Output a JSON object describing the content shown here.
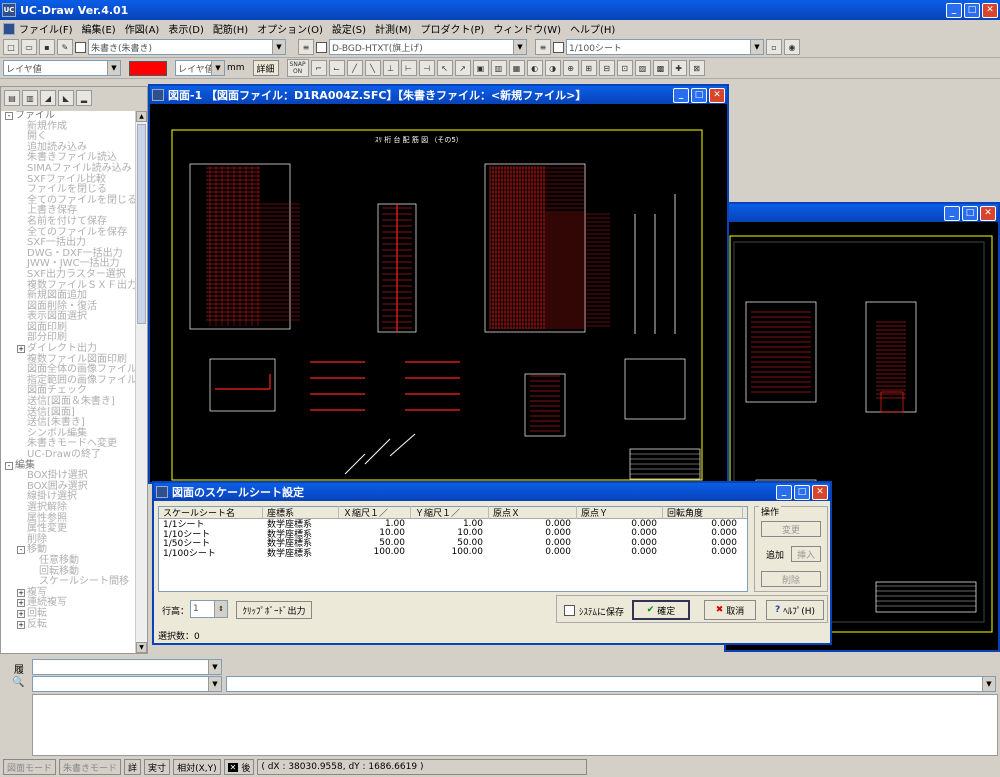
{
  "app": {
    "title": "UC-Draw Ver.4.01"
  },
  "menu": [
    "ファイル(F)",
    "編集(E)",
    "作図(A)",
    "表示(D)",
    "配筋(H)",
    "オプション(O)",
    "設定(S)",
    "計測(M)",
    "プロダクト(P)",
    "ウィンドウ(W)",
    "ヘルプ(H)"
  ],
  "toolbar1": {
    "layer_combo": "朱書き(朱書き)",
    "bgd_combo": "D-BGD-HTXT(旗上げ)",
    "sheet_combo": "1/100シート"
  },
  "toolbar2": {
    "color_combo": "レイヤ値",
    "linetype_combo": "レイヤ値",
    "unit": "mm",
    "detail_button": "詳細",
    "snap_label": "SNAP ON"
  },
  "tree": {
    "items": [
      {
        "t": "ファイル",
        "lv": 0,
        "g": "-"
      },
      {
        "t": "新規作成",
        "lv": 1
      },
      {
        "t": "開く",
        "lv": 1
      },
      {
        "t": "追加読み込み",
        "lv": 1
      },
      {
        "t": "朱書きファイル読込",
        "lv": 1
      },
      {
        "t": "SIMAファイル読み込み",
        "lv": 1
      },
      {
        "t": "SXFファイル比較",
        "lv": 1
      },
      {
        "t": "ファイルを閉じる",
        "lv": 1
      },
      {
        "t": "全てのファイルを閉じる",
        "lv": 1
      },
      {
        "t": "上書き保存",
        "lv": 1
      },
      {
        "t": "名前を付けて保存",
        "lv": 1
      },
      {
        "t": "全てのファイルを保存",
        "lv": 1
      },
      {
        "t": "SXF一括出力",
        "lv": 1
      },
      {
        "t": "DWG・DXF一括出力",
        "lv": 1
      },
      {
        "t": "JWW・JWC一括出力",
        "lv": 1
      },
      {
        "t": "SXF出力ラスター選択",
        "lv": 1
      },
      {
        "t": "複数ファイルＳＸＦ出力",
        "lv": 1
      },
      {
        "t": "新規図面追加",
        "lv": 1
      },
      {
        "t": "図面削除・復活",
        "lv": 1
      },
      {
        "t": "表示図面選択",
        "lv": 1
      },
      {
        "t": "図面印刷",
        "lv": 1
      },
      {
        "t": "部分印刷",
        "lv": 1
      },
      {
        "t": "ダイレクト出力",
        "lv": 1,
        "g": "+"
      },
      {
        "t": "複数ファイル図面印刷",
        "lv": 1
      },
      {
        "t": "図面全体の画像ファイル出力",
        "lv": 1
      },
      {
        "t": "指定範囲の画像ファイル出力",
        "lv": 1
      },
      {
        "t": "図面チェック",
        "lv": 1
      },
      {
        "t": "送信[図面＆朱書き]",
        "lv": 1
      },
      {
        "t": "送信[図面]",
        "lv": 1
      },
      {
        "t": "送信[朱書き]",
        "lv": 1
      },
      {
        "t": "シンボル編集",
        "lv": 1
      },
      {
        "t": "朱書きモードへ変更",
        "lv": 1
      },
      {
        "t": "UC-Drawの終了",
        "lv": 1
      },
      {
        "t": "編集",
        "lv": 0,
        "g": "-"
      },
      {
        "t": "BOX掛け選択",
        "lv": 1
      },
      {
        "t": "BOX囲み選択",
        "lv": 1
      },
      {
        "t": "線掛け選択",
        "lv": 1
      },
      {
        "t": "選択解除",
        "lv": 1
      },
      {
        "t": "属性参照",
        "lv": 1
      },
      {
        "t": "属性変更",
        "lv": 1
      },
      {
        "t": "削除",
        "lv": 1
      },
      {
        "t": "移動",
        "lv": 1,
        "g": "-"
      },
      {
        "t": "任意移動",
        "lv": 2
      },
      {
        "t": "回転移動",
        "lv": 2
      },
      {
        "t": "スケールシート間移",
        "lv": 2
      },
      {
        "t": "複写",
        "lv": 1,
        "g": "+"
      },
      {
        "t": "連続複写",
        "lv": 1,
        "g": "+"
      },
      {
        "t": "回転",
        "lv": 1,
        "g": "+"
      },
      {
        "t": "反転",
        "lv": 1,
        "g": "+"
      }
    ]
  },
  "window1": {
    "title": "図面-1 【図面ファイル：D1RA004Z.SFC】【朱書きファイル：<新規ファイル>】",
    "drawing_title": "ｽﾘ 桁 台 配 筋 図 （その5）"
  },
  "dialog": {
    "title": "図面のスケールシート設定",
    "headers": [
      "スケールシート名",
      "座標系",
      "Ｘ縮尺１／",
      "Ｙ縮尺１／",
      "原点Ｘ",
      "原点Ｙ",
      "回転角度"
    ],
    "rows": [
      [
        "1/1シート",
        "数学座標系",
        "1.00",
        "1.00",
        "0.000",
        "0.000",
        "0.000"
      ],
      [
        "1/10シート",
        "数学座標系",
        "10.00",
        "10.00",
        "0.000",
        "0.000",
        "0.000"
      ],
      [
        "1/50シート",
        "数学座標系",
        "50.00",
        "50.00",
        "0.000",
        "0.000",
        "0.000"
      ],
      [
        "1/100シート",
        "数学座標系",
        "100.00",
        "100.00",
        "0.000",
        "0.000",
        "0.000"
      ]
    ],
    "ops_label": "操作",
    "change": "変更",
    "add": "追加",
    "insert": "挿入",
    "delete": "削除",
    "row_height_label": "行高：",
    "row_height_value": "1",
    "clipboard": "ｸﾘｯﾌﾟﾎﾞｰﾄﾞ出力",
    "save_system": "ｼｽﾃﾑに保存",
    "ok": "確定",
    "cancel": "取消",
    "help": "ﾍﾙﾌﾟ(H)",
    "selection": "選択数：0"
  },
  "bottom": {
    "label1": "履",
    "label2": "🔍"
  },
  "status": {
    "drawing_mode": "図面モード",
    "redline_mode": "朱書きモード",
    "detail": "詳",
    "actual": "実寸",
    "relative": "相対(X,Y)",
    "after": "後",
    "coords": "( dX : 38030.9558, dY : 1686.6619 )"
  }
}
